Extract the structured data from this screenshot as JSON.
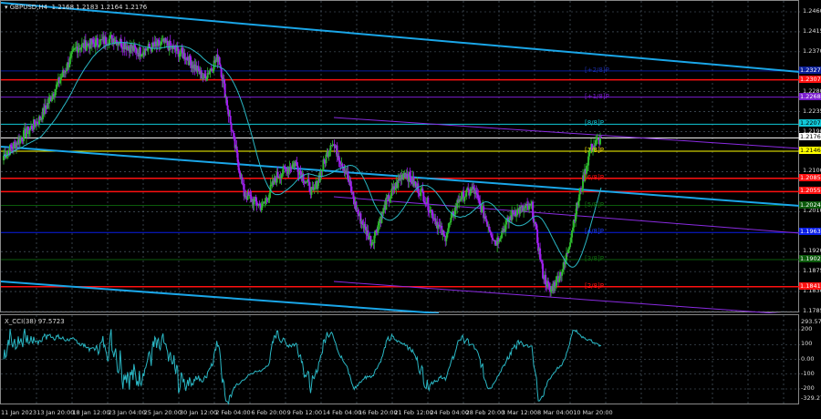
{
  "header": {
    "symbol": "GBPUSD,H4",
    "ohlc": "1.2168 1.2183 1.2164 1.2176"
  },
  "price_axis": {
    "ticks": [
      "1.2460",
      "1.2415",
      "1.2370",
      "1.2280",
      "1.2235",
      "1.2190",
      "1.2100",
      "1.2010",
      "1.1920",
      "1.1875",
      "1.1830",
      "1.1785"
    ],
    "tick_values": [
      1.246,
      1.2415,
      1.237,
      1.228,
      1.2235,
      1.219,
      1.21,
      1.201,
      1.192,
      1.1875,
      1.183,
      1.1785
    ],
    "range": [
      1.1785,
      1.246
    ]
  },
  "levels": [
    {
      "price": 1.2327,
      "text": "1.2327",
      "color": "#0a1e9a",
      "label": "[+2/8]P",
      "lcolor": "#1c2ea8"
    },
    {
      "price": 1.2307,
      "text": "1.2307",
      "color": "#ff1010",
      "label": "",
      "lcolor": ""
    },
    {
      "price": 1.2268,
      "text": "1.2268",
      "color": "#7a1ccf",
      "label": "[+1/8]P",
      "lcolor": "#7a1ccf"
    },
    {
      "price": 1.2207,
      "text": "1.2207",
      "color": "#11c8d8",
      "label": "[8/8]P",
      "lcolor": "#11c8d8"
    },
    {
      "price": 1.2176,
      "text": "1.2176",
      "color": "#ffffff",
      "label": "",
      "lcolor": ""
    },
    {
      "price": 1.2146,
      "text": "1.2146",
      "color": "#ffff00",
      "label": "[7/8]P",
      "lcolor": "#e8d800"
    },
    {
      "price": 1.2085,
      "text": "1.2085",
      "color": "#ff1010",
      "label": "[6/8]P",
      "lcolor": "#ff1010"
    },
    {
      "price": 1.2055,
      "text": "1.2055",
      "color": "#ff1010",
      "label": "",
      "lcolor": ""
    },
    {
      "price": 1.2024,
      "text": "1.2024",
      "color": "#0b5a0b",
      "label": "[5/8]P",
      "lcolor": "#126e12"
    },
    {
      "price": 1.1963,
      "text": "1.1963",
      "color": "#0a1ee8",
      "label": "[4/8]P",
      "lcolor": "#1c3cf0"
    },
    {
      "price": 1.1902,
      "text": "1.1902",
      "color": "#0b5a0b",
      "label": "[3/8]P",
      "lcolor": "#126e12"
    },
    {
      "price": 1.1841,
      "text": "1.1841",
      "color": "#ff1010",
      "label": "[2/8]P",
      "lcolor": "#ff1010"
    }
  ],
  "price_path": [
    [
      0,
      1.2136
    ],
    [
      10,
      1.222
    ],
    [
      20,
      1.238
    ],
    [
      30,
      1.24
    ],
    [
      37,
      1.237
    ],
    [
      44,
      1.239
    ],
    [
      50,
      1.236
    ],
    [
      55,
      1.231
    ],
    [
      59,
      1.236
    ],
    [
      62,
      1.222
    ],
    [
      66,
      1.205
    ],
    [
      71,
      1.202
    ],
    [
      75,
      1.209
    ],
    [
      80,
      1.212
    ],
    [
      85,
      1.205
    ],
    [
      90,
      1.217
    ],
    [
      94,
      1.21
    ],
    [
      97,
      1.201
    ],
    [
      101,
      1.194
    ],
    [
      105,
      1.203
    ],
    [
      110,
      1.21
    ],
    [
      115,
      1.205
    ],
    [
      118,
      1.2
    ],
    [
      121,
      1.195
    ],
    [
      125,
      1.204
    ],
    [
      129,
      1.206
    ],
    [
      132,
      1.2
    ],
    [
      135,
      1.194
    ],
    [
      140,
      1.201
    ],
    [
      145,
      1.202
    ],
    [
      148,
      1.187
    ],
    [
      150,
      1.183
    ],
    [
      154,
      1.189
    ],
    [
      157,
      1.201
    ],
    [
      161,
      1.215
    ],
    [
      164,
      1.2176
    ]
  ],
  "cci": {
    "label": "X_CCI(38) 97.5723",
    "ticks": [
      "293.5774",
      "200",
      "100",
      "0.00",
      "-100",
      "-200",
      "-329.2779"
    ],
    "tick_values": [
      250,
      200,
      100,
      0,
      -100,
      -200,
      -329
    ]
  },
  "time_axis": [
    "11 Jan 2023",
    "13 Jan 20:00",
    "18 Jan 12:00",
    "23 Jan 04:00",
    "25 Jan 20:00",
    "30 Jan 12:00",
    "2 Feb 04:00",
    "6 Feb 20:00",
    "9 Feb 12:00",
    "14 Feb 04:00",
    "16 Feb 20:00",
    "21 Feb 12:00",
    "24 Feb 04:00",
    "28 Feb 20:00",
    "3 Mar 12:00",
    "8 Mar 04:00",
    "10 Mar 20:00"
  ],
  "colors": {
    "bull": "#2eb82e",
    "bear": "#a020f0",
    "ma": "#2ab7c4",
    "trend": "#1aa6e8",
    "channel": "#8a2be2",
    "cci": "#2ab7c4",
    "grid": "#5a6a7a"
  }
}
